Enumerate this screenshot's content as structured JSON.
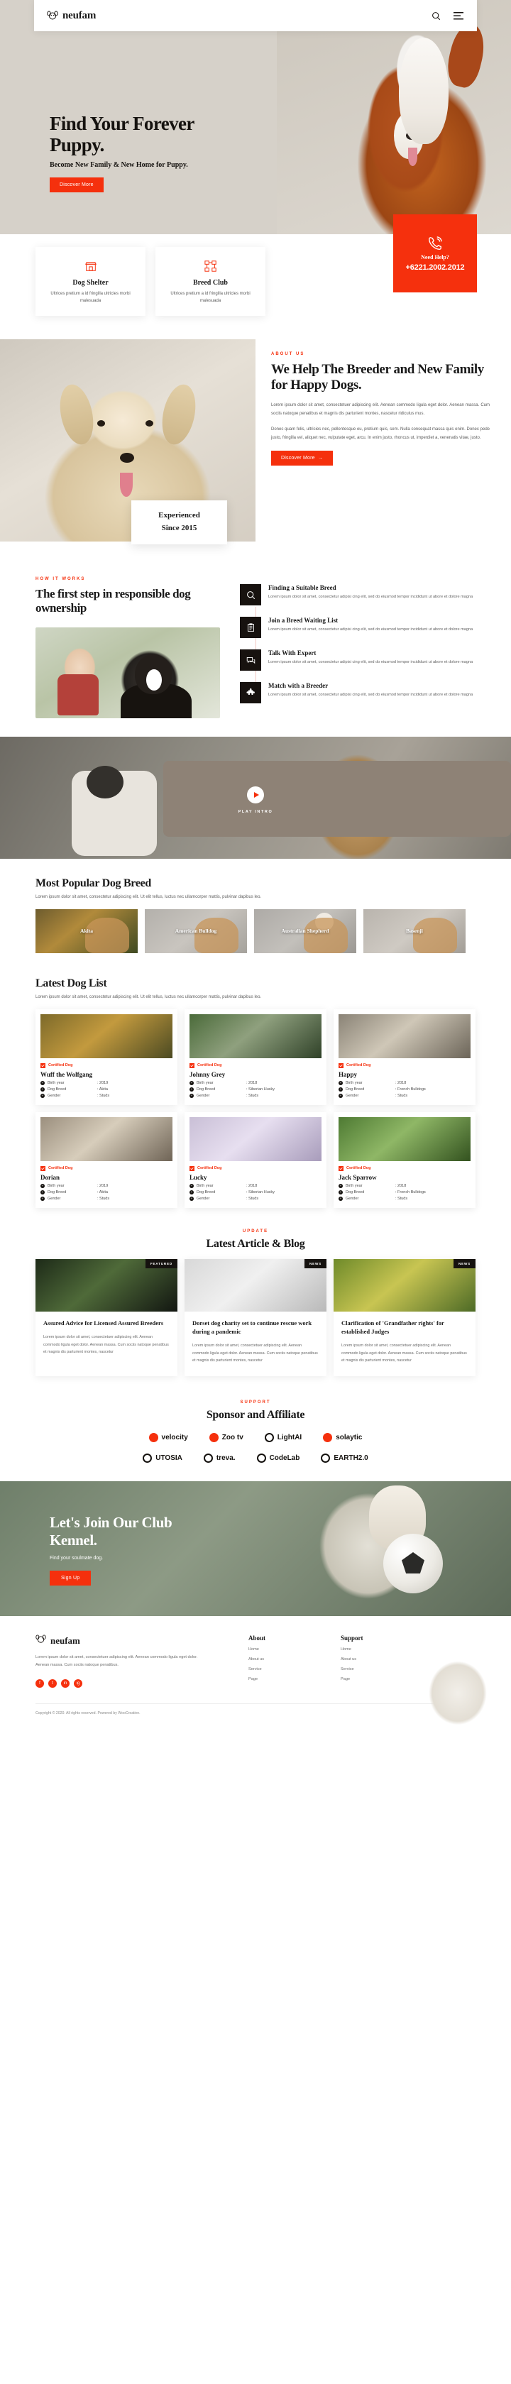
{
  "header": {
    "brand": "neufam",
    "search_icon": "search-icon",
    "menu_icon": "hamburger-menu-icon"
  },
  "hero": {
    "title_line1": "Find Your Forever",
    "title_line2": "Puppy.",
    "subtitle": "Become New Family & New Home for Puppy.",
    "cta": "Discover More"
  },
  "services": {
    "cards": [
      {
        "icon": "store-icon",
        "title": "Dog Shelter",
        "desc": "Ultrices pretium a id fringilla ultricies morbi malesuada"
      },
      {
        "icon": "network-icon",
        "title": "Breed Club",
        "desc": "Ultrices pretium a id fringilla ultricies morbi malesuada"
      }
    ],
    "help": {
      "icon": "phone-icon",
      "label": "Need Help?",
      "number": "+6221.2002.2012"
    }
  },
  "about": {
    "eyebrow": "ABOUT US",
    "title": "We Help The Breeder and New Family for Happy Dogs.",
    "p1": "Lorem ipsum dolor sit amet, consectetuer adipiscing elit. Aenean commodo ligula eget dolor. Aenean massa. Cum sociis natoque penatibus et magnis dis parturient montes, nascetur ridiculus mus.",
    "p2": "Donec quam felis, ultricies nec, pellentesque eu, pretium quis, sem. Nulla consequat massa quis enim. Donec pede justo, fringilla vel, aliquet nec, vulputate eget, arcu. In enim justo, rhoncus ut, imperdiet a, venenatis vitae, justo.",
    "cta": "Discover More",
    "badge_line1": "Experienced",
    "badge_line2": "Since 2015"
  },
  "how": {
    "eyebrow": "HOW IT WORKS",
    "title": "The first step in responsible dog ownership",
    "steps": [
      {
        "icon": "search-icon",
        "title": "Finding a Suitable Breed",
        "desc": "Lorem ipsum dolor sit amet, consectetur adipisi cing elit, sed do eiusmod tempor incididunt ut abore et dolore magna"
      },
      {
        "icon": "clipboard-icon",
        "title": "Join a Breed Waiting List",
        "desc": "Lorem ipsum dolor sit amet, consectetur adipisi cing elit, sed do eiusmod tempor incididunt ut abore et dolore magna"
      },
      {
        "icon": "chat-icon",
        "title": "Talk With Expert",
        "desc": "Lorem ipsum dolor sit amet, consectetur adipisi cing elit, sed do eiusmod tempor incididunt ut abore et dolore magna"
      },
      {
        "icon": "puzzle-icon",
        "title": "Match with a Breeder",
        "desc": "Lorem ipsum dolor sit amet, consectetur adipisi cing elit, sed do eiusmod tempor incididunt ut abore et dolore magna"
      }
    ]
  },
  "video": {
    "play_icon": "play-icon",
    "label": "PLAY INTRO"
  },
  "breeds": {
    "title": "Most Popular Dog Breed",
    "subtitle": "Lorem ipsum dolor sit amet, consectetur adipiscing elit. Ut elit tellus, luctus nec ullamcorper mattis, pulvinar dapibus leo.",
    "items": [
      {
        "name": "Akita"
      },
      {
        "name": "American Bulldog"
      },
      {
        "name": "Australian Shepherd"
      },
      {
        "name": "Basenji"
      }
    ]
  },
  "dogs": {
    "title": "Latest Dog List",
    "subtitle": "Lorem ipsum dolor sit amet, consectetur adipiscing elit. Ut elit tellus, luctus nec ullamcorper mattis, pulvinar dapibus leo.",
    "badge": "Certified Dog",
    "labels": {
      "birth": "Birth year",
      "breed": "Dog Breed",
      "gender": "Gender"
    },
    "items": [
      {
        "name": "Wuff the Wolfgang",
        "birth": ": 2019",
        "breed": ": Akita",
        "gender": ": Studs"
      },
      {
        "name": "Johnny Grey",
        "birth": ": 2018",
        "breed": ": Siberian Husky",
        "gender": ": Studs"
      },
      {
        "name": "Happy",
        "birth": ": 2018",
        "breed": ": French Bulldogs",
        "gender": ": Studs"
      },
      {
        "name": "Dorian",
        "birth": ": 2019",
        "breed": ": Akita",
        "gender": ": Studs"
      },
      {
        "name": "Lucky",
        "birth": ": 2018",
        "breed": ": Siberian Husky",
        "gender": ": Studs"
      },
      {
        "name": "Jack Sparrow",
        "birth": ": 2018",
        "breed": ": French Bulldogs",
        "gender": ": Studs"
      }
    ]
  },
  "blog": {
    "eyebrow": "UPDATE",
    "title": "Latest Article & Blog",
    "items": [
      {
        "tag": "FEATURED",
        "title": "Assured Advice for Licensed Assured Breeders",
        "excerpt": "Lorem ipsum dolor sit amet, consectetuer adipiscing elit. Aenean commodo ligula eget dolor. Aenean massa. Cum sociis natoque penatibus et magnis dis parturient montes, nascetur"
      },
      {
        "tag": "NEWS",
        "title": "Dorset dog charity set to continue rescue work during a pandemic",
        "excerpt": "Lorem ipsum dolor sit amet, consectetuer adipiscing elit. Aenean commodo ligula eget dolor. Aenean massa. Cum sociis natoque penatibus et magnis dis parturient montes, nascetur"
      },
      {
        "tag": "NEWS",
        "title": "Clarification of 'Grandfather rights' for established Judges",
        "excerpt": "Lorem ipsum dolor sit amet, consectetuer adipiscing elit. Aenean commodo ligula eget dolor. Aenean massa. Cum sociis natoque penatibus et magnis dis parturient montes, nascetur"
      }
    ]
  },
  "sponsors": {
    "eyebrow": "SUPPORT",
    "title": "Sponsor and Affiliate",
    "row1": [
      {
        "name": "velocity",
        "mark": "dot"
      },
      {
        "name": "Zoo tv",
        "mark": "dot"
      },
      {
        "name": "LightAI",
        "mark": "ring"
      },
      {
        "name": "solaytic",
        "mark": "dot"
      }
    ],
    "row2": [
      {
        "name": "UTOSIA",
        "mark": "ring"
      },
      {
        "name": "treva.",
        "mark": "ring"
      },
      {
        "name": "CodeLab",
        "mark": "ring"
      },
      {
        "name": "EARTH2.0",
        "mark": "ring"
      }
    ]
  },
  "cta": {
    "title_line1": "Let's Join Our Club",
    "title_line2": "Kennel.",
    "subtitle": "Find your soulmate dog.",
    "button": "Sign Up"
  },
  "footer": {
    "brand": "neufam",
    "desc": "Lorem ipsum dolor sit amet, consectetuer adipiscing elit. Aenean commodo ligula eget dolor. Aenean massa. Cum sociis natoque penatibus.",
    "socials": [
      "f",
      "t",
      "in",
      "ig"
    ],
    "columns": [
      {
        "heading": "About",
        "links": [
          "Home",
          "About us",
          "Service",
          "Page"
        ]
      },
      {
        "heading": "Support",
        "links": [
          "Home",
          "About us",
          "Service",
          "Page"
        ]
      }
    ],
    "copyright": "Copyright © 2020. All rights reserved. Powered by WooCreative."
  }
}
